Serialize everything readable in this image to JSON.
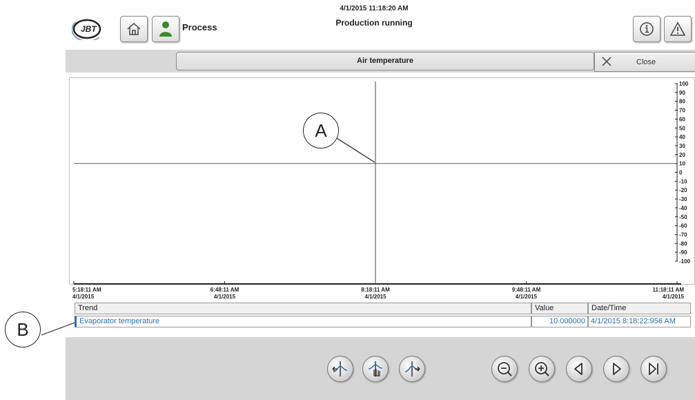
{
  "header": {
    "date_time": "4/1/2015 11:18:20 AM",
    "status": "Production running",
    "process_label": "Process",
    "logo_text": "JBT",
    "icons": [
      "home-icon",
      "user-icon",
      "info-icon",
      "warning-icon"
    ]
  },
  "title_bar": {
    "title": "Air temperature",
    "close_label": "Close"
  },
  "chart_data": {
    "type": "line",
    "title": "Air temperature",
    "x_labels": [
      {
        "time": "5:18:11 AM",
        "date": "4/1/2015"
      },
      {
        "time": "6:48:11 AM",
        "date": "4/1/2015"
      },
      {
        "time": "8:18:11 AM",
        "date": "4/1/2015"
      },
      {
        "time": "9:48:11 AM",
        "date": "4/1/2015"
      },
      {
        "time": "11:18:11 AM",
        "date": "4/1/2015"
      }
    ],
    "y_ticks": [
      100,
      90,
      80,
      70,
      60,
      50,
      40,
      30,
      20,
      10,
      0,
      -10,
      -20,
      -30,
      -40,
      -50,
      -60,
      -70,
      -80,
      -90,
      -100
    ],
    "ylim": [
      -100,
      100
    ],
    "series": [
      {
        "name": "Evaporator temperature",
        "color": "#2a6fb8",
        "x": [
          "5:18:11 AM",
          "11:18:11 AM"
        ],
        "values": [
          10,
          10
        ]
      }
    ],
    "cursor_time": "8:18:11 AM"
  },
  "table": {
    "headers": {
      "trend": "Trend",
      "value": "Value",
      "datetime": "Date/Time"
    },
    "rows": [
      {
        "trend": "Evaporator temperature",
        "value": "10.000000",
        "datetime": "4/1/2015 8:18:22:956 AM"
      }
    ]
  },
  "callouts": {
    "a": "A",
    "b": "B"
  },
  "toolbar": {
    "buttons": [
      "ruler-left-icon",
      "ruler-hand-icon",
      "ruler-right-icon",
      "zoom-out-icon",
      "zoom-in-icon",
      "play-back-icon",
      "play-forward-icon",
      "skip-end-icon"
    ]
  },
  "colors": {
    "series": "#2a6fb8",
    "panel": "#d5d5d5",
    "titlebar": "#d8d8d8"
  }
}
